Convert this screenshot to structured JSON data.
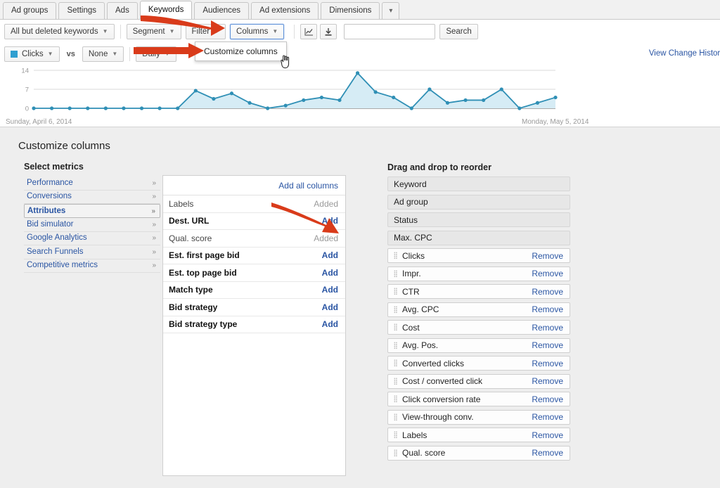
{
  "tabs": [
    {
      "label": "Ad groups",
      "active": false
    },
    {
      "label": "Settings",
      "active": false
    },
    {
      "label": "Ads",
      "active": false
    },
    {
      "label": "Keywords",
      "active": true
    },
    {
      "label": "Audiences",
      "active": false
    },
    {
      "label": "Ad extensions",
      "active": false
    },
    {
      "label": "Dimensions",
      "active": false
    },
    {
      "label": "▾",
      "active": false
    }
  ],
  "toolbar": {
    "keyword_filter_label": "All but deleted keywords",
    "segment_label": "Segment",
    "filter_label": "Filter",
    "columns_label": "Columns",
    "chart_icon": "line-chart-icon",
    "download_icon": "download-icon",
    "search_value": "",
    "search_placeholder": "",
    "search_button_label": "Search"
  },
  "dropdown": {
    "item_label": "Customize columns"
  },
  "legend": {
    "metric_label": "Clicks",
    "vs_label": "vs",
    "compare_label": "None",
    "granularity_label": "Daily",
    "swatch_color": "#2f9fd0",
    "change_history_label": "View Change History"
  },
  "chart_data": {
    "type": "line",
    "title": "",
    "xlabel": "",
    "ylabel": "",
    "ylim": [
      0,
      14
    ],
    "yticks": [
      0,
      7,
      14
    ],
    "grid": true,
    "legend_position": "above-chart",
    "line_color": "#2f8fb5",
    "fill_color": "#d6ecf5",
    "start_label": "Sunday, April 6, 2014",
    "end_label": "Monday, May 5, 2014",
    "series": [
      {
        "name": "Clicks",
        "values": [
          0,
          0,
          0,
          0,
          0,
          0,
          0,
          0,
          0,
          6.5,
          3.5,
          5.5,
          2,
          0,
          1,
          3,
          4,
          3,
          13,
          6,
          4,
          0,
          7,
          2,
          3,
          3,
          7,
          0,
          2,
          4
        ]
      }
    ]
  },
  "panel": {
    "title": "Customize columns",
    "select_metrics_title": "Select metrics",
    "reorder_title": "Drag and drop to reorder",
    "chevron_glyph": "»",
    "categories": [
      {
        "label": "Performance",
        "selected": false
      },
      {
        "label": "Conversions",
        "selected": false
      },
      {
        "label": "Attributes",
        "selected": true
      },
      {
        "label": "Bid simulator",
        "selected": false
      },
      {
        "label": "Google Analytics",
        "selected": false
      },
      {
        "label": "Search Funnels",
        "selected": false
      },
      {
        "label": "Competitive metrics",
        "selected": false
      }
    ],
    "add_all_label": "Add all columns",
    "metrics": [
      {
        "name": "Labels",
        "action": "Added",
        "state": "added"
      },
      {
        "name": "Dest. URL",
        "action": "Add",
        "state": "addable"
      },
      {
        "name": "Qual. score",
        "action": "Added",
        "state": "added"
      },
      {
        "name": "Est. first page bid",
        "action": "Add",
        "state": "addable"
      },
      {
        "name": "Est. top page bid",
        "action": "Add",
        "state": "addable"
      },
      {
        "name": "Match type",
        "action": "Add",
        "state": "addable"
      },
      {
        "name": "Bid strategy",
        "action": "Add",
        "state": "addable"
      },
      {
        "name": "Bid strategy type",
        "action": "Add",
        "state": "addable"
      }
    ],
    "selected_columns": [
      {
        "name": "Keyword",
        "fixed": true,
        "action": ""
      },
      {
        "name": "Ad group",
        "fixed": true,
        "action": ""
      },
      {
        "name": "Status",
        "fixed": true,
        "action": ""
      },
      {
        "name": "Max. CPC",
        "fixed": true,
        "action": ""
      },
      {
        "name": "Clicks",
        "fixed": false,
        "action": "Remove"
      },
      {
        "name": "Impr.",
        "fixed": false,
        "action": "Remove"
      },
      {
        "name": "CTR",
        "fixed": false,
        "action": "Remove"
      },
      {
        "name": "Avg. CPC",
        "fixed": false,
        "action": "Remove"
      },
      {
        "name": "Cost",
        "fixed": false,
        "action": "Remove"
      },
      {
        "name": "Avg. Pos.",
        "fixed": false,
        "action": "Remove"
      },
      {
        "name": "Converted clicks",
        "fixed": false,
        "action": "Remove"
      },
      {
        "name": "Cost / converted click",
        "fixed": false,
        "action": "Remove"
      },
      {
        "name": "Click conversion rate",
        "fixed": false,
        "action": "Remove"
      },
      {
        "name": "View-through conv.",
        "fixed": false,
        "action": "Remove"
      },
      {
        "name": "Labels",
        "fixed": false,
        "action": "Remove"
      },
      {
        "name": "Qual. score",
        "fixed": false,
        "action": "Remove"
      }
    ]
  },
  "annotations": {
    "arrow_color": "#d93b1a",
    "arrow1_target": "columns-button",
    "arrow2_target": "customize-columns-menu-item",
    "arrow3_target": "qual-score-added-status",
    "cursor": "hand-pointer"
  }
}
